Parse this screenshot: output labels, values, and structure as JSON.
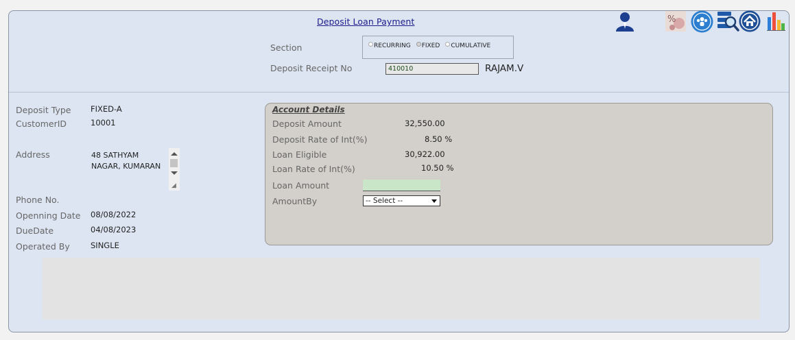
{
  "header": {
    "title": "Deposit Loan Payment",
    "section_label": "Section",
    "receipt_label": "Deposit Receipt No",
    "receipt_value": "410010",
    "customer_name": "RAJAM.V",
    "radios": [
      {
        "label": "RECURRING",
        "selected": false
      },
      {
        "label": "FIXED",
        "selected": true
      },
      {
        "label": "CUMULATIVE",
        "selected": false
      }
    ]
  },
  "toolbar_icons": [
    "user-icon",
    "interest-icon",
    "team-icon",
    "search-list-icon",
    "home-icon",
    "bar-chart-icon"
  ],
  "details": {
    "deposit_type_label": "Deposit Type",
    "deposit_type_value": "FIXED-A",
    "customer_id_label": "CustomerID",
    "customer_id_value": "10001",
    "address_label": "Address",
    "address_value": "48 SATHYAM NAGAR, KUMARAN",
    "phone_label": "Phone No.",
    "opening_label": "Openning Date",
    "opening_value": "08/08/2022",
    "due_label": "DueDate",
    "due_value": "04/08/2023",
    "operated_label": "Operated By",
    "operated_value": "SINGLE"
  },
  "account": {
    "title": "Account Details",
    "deposit_amount_label": "Deposit Amount",
    "deposit_amount_value": "32,550.00",
    "deposit_rate_label": "Deposit Rate of Int(%)",
    "deposit_rate_value": "8.50 %",
    "loan_eligible_label": "Loan Eligible",
    "loan_eligible_value": "30,922.00",
    "loan_rate_label": "Loan Rate of Int(%)",
    "loan_rate_value": "10.50 %",
    "loan_amount_label": "Loan Amount",
    "amount_by_label": "AmountBy",
    "amount_by_selected": "-- Select --"
  },
  "colors": {
    "panel_bg": "#dde5f2",
    "account_bg": "#d3cfca",
    "loan_input_bg": "#c9e6c9",
    "title_color": "#1a1a8c"
  }
}
